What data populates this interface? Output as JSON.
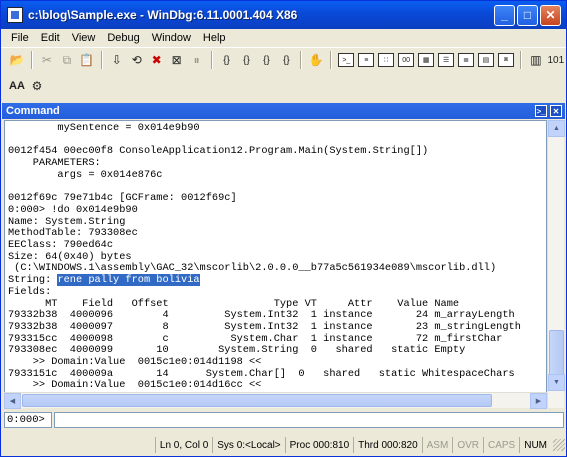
{
  "window": {
    "title": "c:\\blog\\Sample.exe - WinDbg:6.11.0001.404 X86"
  },
  "menu": [
    "File",
    "Edit",
    "View",
    "Debug",
    "Window",
    "Help"
  ],
  "toolbar_glyphs": {
    "open": "📂",
    "cut": "✂",
    "copy": "⧉",
    "paste": "📋",
    "step_into": "{}",
    "step_over": "{}",
    "step_out": "{}",
    "run_to_cursor": "{}",
    "hand": "✋",
    "font": "AA",
    "options": "⚙",
    "hex": "101"
  },
  "pane": {
    "title": "Command"
  },
  "output_lines": [
    "        mySentence = 0x014e9b90",
    "",
    "0012f454 00ec00f8 ConsoleApplication12.Program.Main(System.String[])",
    "    PARAMETERS:",
    "        args = 0x014e876c",
    "",
    "0012f69c 79e71b4c [GCFrame: 0012f69c]",
    "0:000> !do 0x014e9b90",
    "Name: System.String",
    "MethodTable: 793308ec",
    "EEClass: 790ed64c",
    "Size: 64(0x40) bytes",
    " (C:\\WINDOWS.1\\assembly\\GAC_32\\mscorlib\\2.0.0.0__b77a5c561934e089\\mscorlib.dll)",
    "String: ",
    "Fields:",
    "      MT    Field   Offset                 Type VT     Attr    Value Name",
    "79332b38  4000096        4         System.Int32  1 instance       24 m_arrayLength",
    "79332b38  4000097        8         System.Int32  1 instance       23 m_stringLength",
    "793315cc  4000098        c          System.Char  1 instance       72 m_firstChar",
    "793308ec  4000099       10        System.String  0   shared   static Empty",
    "    >> Domain:Value  0015c1e0:014d1198 <<",
    "7933151c  400009a       14      System.Char[]  0   shared   static WhitespaceChars",
    "    >> Domain:Value  0015c1e0:014d16cc <<"
  ],
  "highlighted_string": "rene pally from bolivia",
  "command": {
    "prompt": "0:000>",
    "value": ""
  },
  "status": {
    "position": "Ln 0, Col 0",
    "sys": "Sys 0:<Local>",
    "proc": "Proc 000:810",
    "thread": "Thrd 000:820",
    "asm": "ASM",
    "ovr": "OVR",
    "caps": "CAPS",
    "num": "NUM"
  }
}
